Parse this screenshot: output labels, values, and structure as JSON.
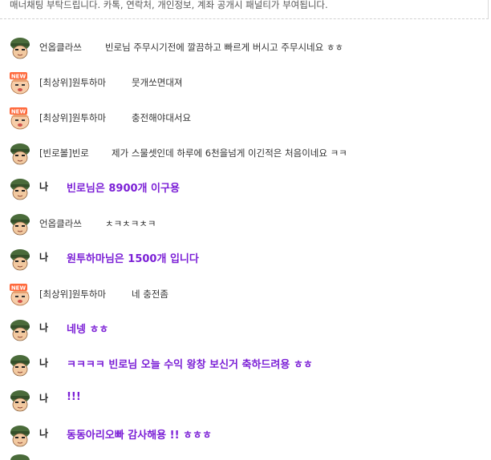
{
  "notice": "매너채팅 부탁드립니다. 카톡, 연락처, 개인정보, 계좌 공개시 패널티가 부여됩니다.",
  "colors": {
    "my_message": "#7b1fd6",
    "other_message": "#333333"
  },
  "messages": [
    {
      "nick": "언옵클라쓰",
      "text": "빈로님 주무시기전에 깔끔하고 빠르게 버시고 주무시네요 ㅎㅎ",
      "avatar": "soldier-avatar",
      "me": false
    },
    {
      "nick": "[최상위]원투하마",
      "text": "뭇개쏘면대져",
      "avatar": "new-badge-avatar",
      "me": false
    },
    {
      "nick": "[최상위]원투하마",
      "text": "충전해야대서요",
      "avatar": "new-badge-avatar",
      "me": false
    },
    {
      "nick": "[빈로볼]빈로",
      "text": "제가 스물셋인데 하루에 6천을넘게 이긴적은 처음이네요 ㅋㅋ",
      "avatar": "soldier-avatar",
      "me": false
    },
    {
      "nick": "나",
      "text": "빈로님은 8900개 이구용",
      "avatar": "soldier-avatar",
      "me": true
    },
    {
      "nick": "언옵클라쓰",
      "text": "ㅊㅋㅊㅋㅊㅋ",
      "avatar": "soldier-avatar",
      "me": false
    },
    {
      "nick": "나",
      "text": "원투하마님은 1500개 입니다",
      "avatar": "soldier-avatar",
      "me": true
    },
    {
      "nick": "[최상위]원투하마",
      "text": "네 충전좀",
      "avatar": "new-badge-avatar",
      "me": false
    },
    {
      "nick": "나",
      "text": "네넹 ㅎㅎ",
      "avatar": "soldier-avatar",
      "me": true
    },
    {
      "nick": "나",
      "text": "ㅋㅋㅋㅋ 빈로님 오늘 수익 왕창 보신거 축하드려용 ㅎㅎ",
      "avatar": "soldier-avatar",
      "me": true
    },
    {
      "nick": "나",
      "text": "!!!",
      "avatar": "soldier-avatar",
      "me": true
    },
    {
      "nick": "나",
      "text": "동동아리오빠 감사해용 !! ㅎㅎㅎ",
      "avatar": "soldier-avatar",
      "me": true
    }
  ]
}
